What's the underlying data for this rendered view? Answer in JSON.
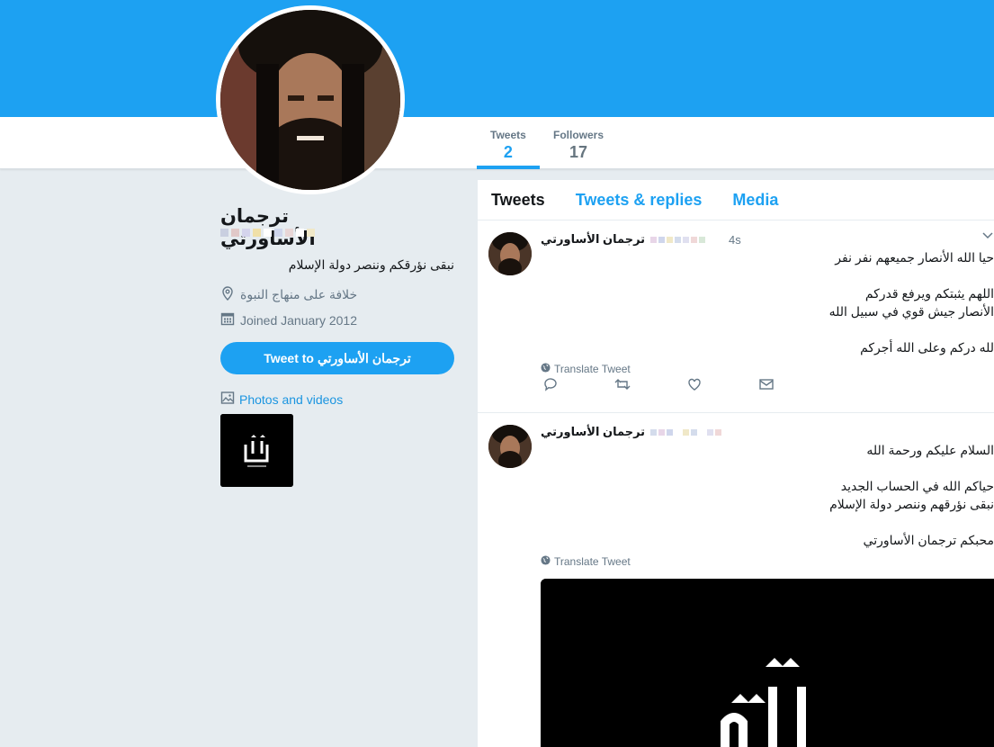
{
  "profile": {
    "name": "ترجمان الأساورتي",
    "bio": "نبقى نؤرقكم وننصر دولة الإسلام",
    "location": "خلافة على منهاج النبوة",
    "joined": "Joined January 2012",
    "tweet_to_prefix": "Tweet to",
    "tweet_to_name": "ترجمان الأساورتي",
    "photos_label": "Photos and videos"
  },
  "stats": [
    {
      "label": "Tweets",
      "value": "2"
    },
    {
      "label": "Followers",
      "value": "17"
    }
  ],
  "timeline_tabs": [
    "Tweets",
    "Tweets & replies",
    "Media"
  ],
  "tweets": [
    {
      "author": "ترجمان الأساورتي",
      "time": "4s",
      "lines": [
        "حيا الله الأنصار جميعهم نفر نفر",
        "",
        "اللهم يثبتكم ويرفع قدركم",
        "الأنصار جيش قوي في سبيل الله",
        "",
        "لله دركم وعلى الله أجركم"
      ],
      "translate": "Translate Tweet"
    },
    {
      "author": "ترجمان الأساورتي",
      "lines": [
        "السلام عليكم ورحمة الله",
        "",
        "حياكم الله في الحساب الجديد",
        "نبقى نؤرقهم وننصر دولة الإسلام",
        "",
        "محبكم ترجمان الأساورتي"
      ],
      "translate": "Translate Tweet"
    }
  ],
  "colors": {
    "accent": "#1da1f2",
    "background": "#e6ecf0",
    "muted": "#657786"
  },
  "icons": [
    "location-icon",
    "calendar-icon",
    "image-icon",
    "globe-icon",
    "reply-icon",
    "retweet-icon",
    "like-icon",
    "message-icon",
    "caret-down-icon"
  ]
}
